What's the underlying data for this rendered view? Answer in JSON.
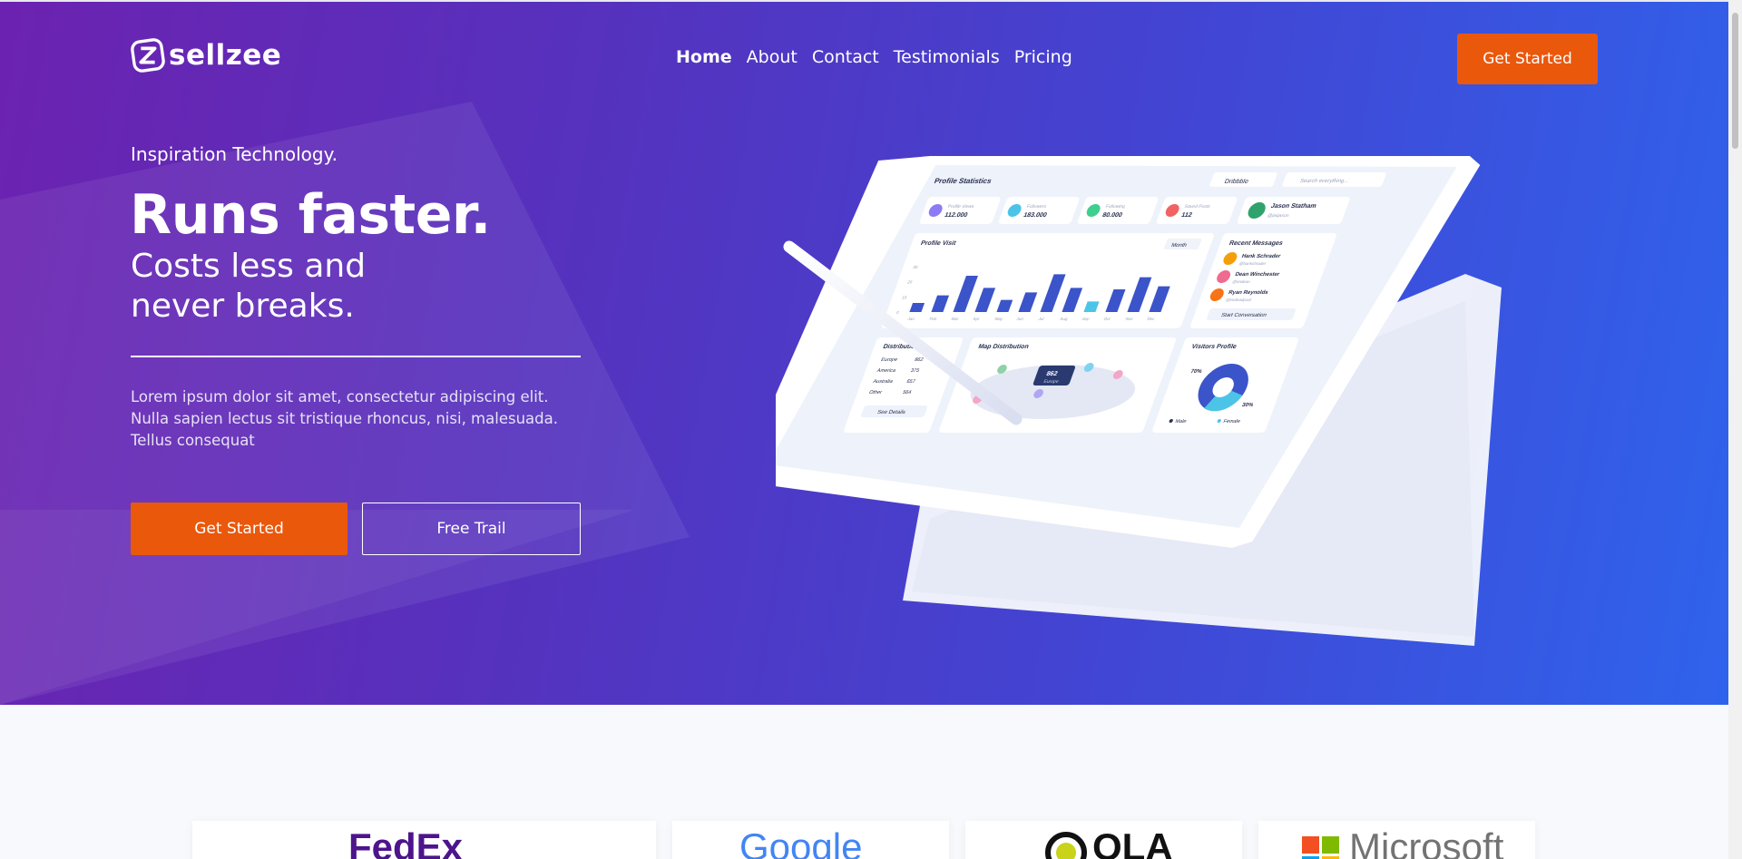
{
  "brand": {
    "name": "sellzee",
    "colors": {
      "accent": "#ea580c",
      "gradient_start": "#6c22b0",
      "gradient_end": "#2f63ec"
    }
  },
  "nav": {
    "items": [
      "Home",
      "About",
      "Contact",
      "Testimonials",
      "Pricing"
    ],
    "active": "Home"
  },
  "header": {
    "cta_label": "Get Started"
  },
  "hero": {
    "eyebrow": "Inspiration Technology.",
    "headline": "Runs faster.",
    "subhead_line1": "Costs less and",
    "subhead_line2": "never breaks.",
    "description": "Lorem ipsum dolor sit amet, consectetur adipiscing elit. Nulla sapien lectus sit tristique rhoncus, nisi, malesuada. Tellus consequat",
    "primary_cta": "Get Started",
    "secondary_cta": "Free Trail"
  },
  "dashboard": {
    "profile_statistics": "Profile Statistics",
    "source_select": "Dribbble",
    "search_placeholder": "Search everything...",
    "stats": [
      {
        "label": "Profile Views",
        "value": "112.000"
      },
      {
        "label": "Followers",
        "value": "183.000"
      },
      {
        "label": "Following",
        "value": "80.000"
      },
      {
        "label": "Saved Posts",
        "value": "112"
      }
    ],
    "user": {
      "name": "Jason Statham",
      "handle": "@jasjason"
    },
    "profile_visit": {
      "title": "Profile Visit",
      "period": "Month",
      "y_ticks": [
        "30",
        "20",
        "10",
        "0"
      ],
      "months": [
        "Jan",
        "Feb",
        "Mar",
        "Apr",
        "May",
        "Jun",
        "Jul",
        "Aug",
        "Sep",
        "Oct",
        "Nov",
        "Dec"
      ],
      "values": [
        6,
        11,
        24,
        16,
        8,
        13,
        25,
        16,
        7,
        15,
        23,
        17
      ]
    },
    "recent_messages": {
      "title": "Recent Messages",
      "people": [
        {
          "name": "Hank Schrader",
          "handle": "@hankshrader"
        },
        {
          "name": "Dean Winchester",
          "handle": "@imdean"
        },
        {
          "name": "Ryan Reynolds",
          "handle": "@imdeadpool"
        }
      ],
      "button": "Start Conversation"
    },
    "distribution": {
      "title": "Distribution",
      "rows": [
        {
          "region": "Europe",
          "value": "862"
        },
        {
          "region": "America",
          "value": "375"
        },
        {
          "region": "Australia",
          "value": "657"
        },
        {
          "region": "Other",
          "value": "564"
        }
      ],
      "button": "See Details"
    },
    "map": {
      "title": "Map Distribution",
      "tooltip_value": "862",
      "tooltip_label": "Europe"
    },
    "visitors": {
      "title": "Visitors Profile",
      "male_pct": "70%",
      "female_pct": "30%",
      "legend_male": "Male",
      "legend_female": "Female"
    }
  },
  "partners": {
    "items": [
      "FedEx",
      "Google",
      "OLA",
      "Microsoft"
    ]
  }
}
